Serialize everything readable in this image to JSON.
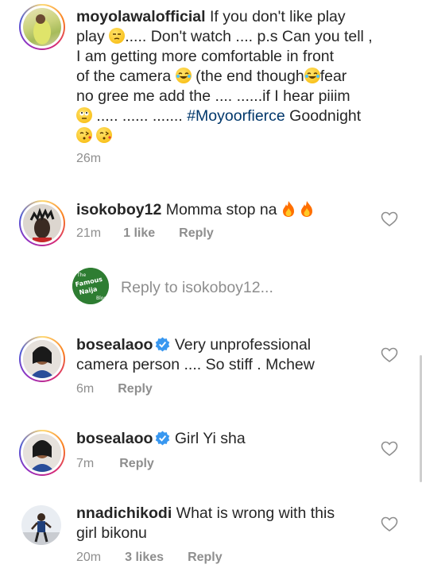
{
  "comments": [
    {
      "username": "moyolawalofficial",
      "line1_text": " If you don't like play",
      "line2_prefix": "play ",
      "line2_suffix": "..... Don't watch .... p.s Can you tell ,",
      "line3": "I am getting more comfortable in front",
      "line4_prefix": "of the camera ",
      "line4_mid": " (the end though",
      "line4_suffix": "fear",
      "line5": "no gree me add the .... ......if I hear piiim",
      "line6_mid": " ..... ...... ....... ",
      "hashtag": "#Moyoorfierce",
      "line6_suffix": "  Goodnight",
      "time": "26m"
    },
    {
      "username": "isokoboy12",
      "text": " Momma stop na ",
      "time": "21m",
      "likes": "1 like",
      "reply": "Reply"
    },
    {
      "username": "bosealaoo",
      "line1": "  Very unprofessional",
      "line2": "camera person .... So stiff . Mchew",
      "time": "6m",
      "reply": "Reply"
    },
    {
      "username": "bosealaoo",
      "text": "  Girl Yi sha",
      "time": "7m",
      "reply": "Reply"
    },
    {
      "username": "nnadichikodi",
      "line1": " What is wrong with this",
      "line2": "girl bikonu",
      "time": "20m",
      "likes": "3 likes",
      "reply": "Reply"
    }
  ],
  "reply_box": {
    "placeholder": "Reply to isokoboy12...",
    "logo_text_1": "The",
    "logo_text_2": "Famous",
    "logo_text_3": "Naija",
    "logo_text_4": "Blog"
  },
  "colors": {
    "text": "#262626",
    "meta": "#8e8e8e",
    "hashtag": "#00376b",
    "verified": "#3897f0",
    "logo_green": "#2e7d32"
  }
}
